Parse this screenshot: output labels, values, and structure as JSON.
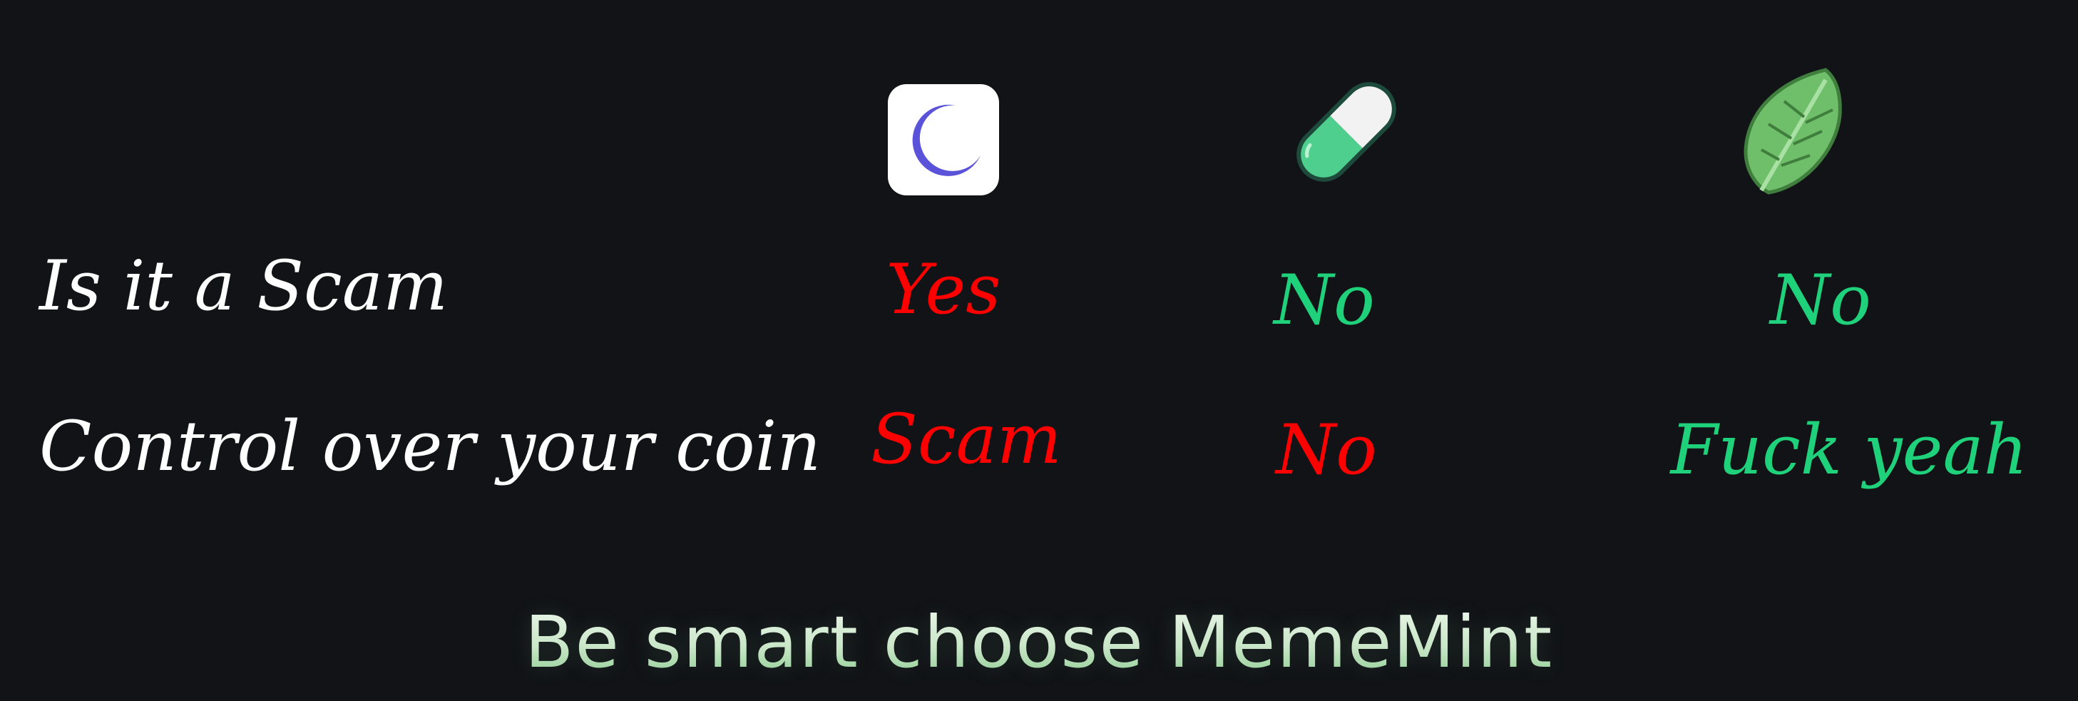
{
  "columns": [
    {
      "id": "moon",
      "icon": "moon-app-icon"
    },
    {
      "id": "pill",
      "icon": "pill-capsule-icon"
    },
    {
      "id": "leaf",
      "icon": "mint-leaf-icon"
    }
  ],
  "rows": [
    {
      "label": "Is it a Scam",
      "values": [
        "Yes",
        "No",
        "No"
      ]
    },
    {
      "label": "Control over your coin",
      "values": [
        "Scam",
        "No",
        "Fuck yeah"
      ]
    }
  ],
  "colors": {
    "background": "#111317",
    "negative": "#ff0000",
    "positive": "#1fd17a",
    "label": "#ffffff",
    "moon_tile": "#ffffff",
    "moon": "#5a52d9",
    "pill_green": "#4ecf8e",
    "pill_white": "#f2f2f2",
    "leaf": "#6fbf6a"
  },
  "footer": {
    "tagline": "Be smart choose MemeMint"
  }
}
